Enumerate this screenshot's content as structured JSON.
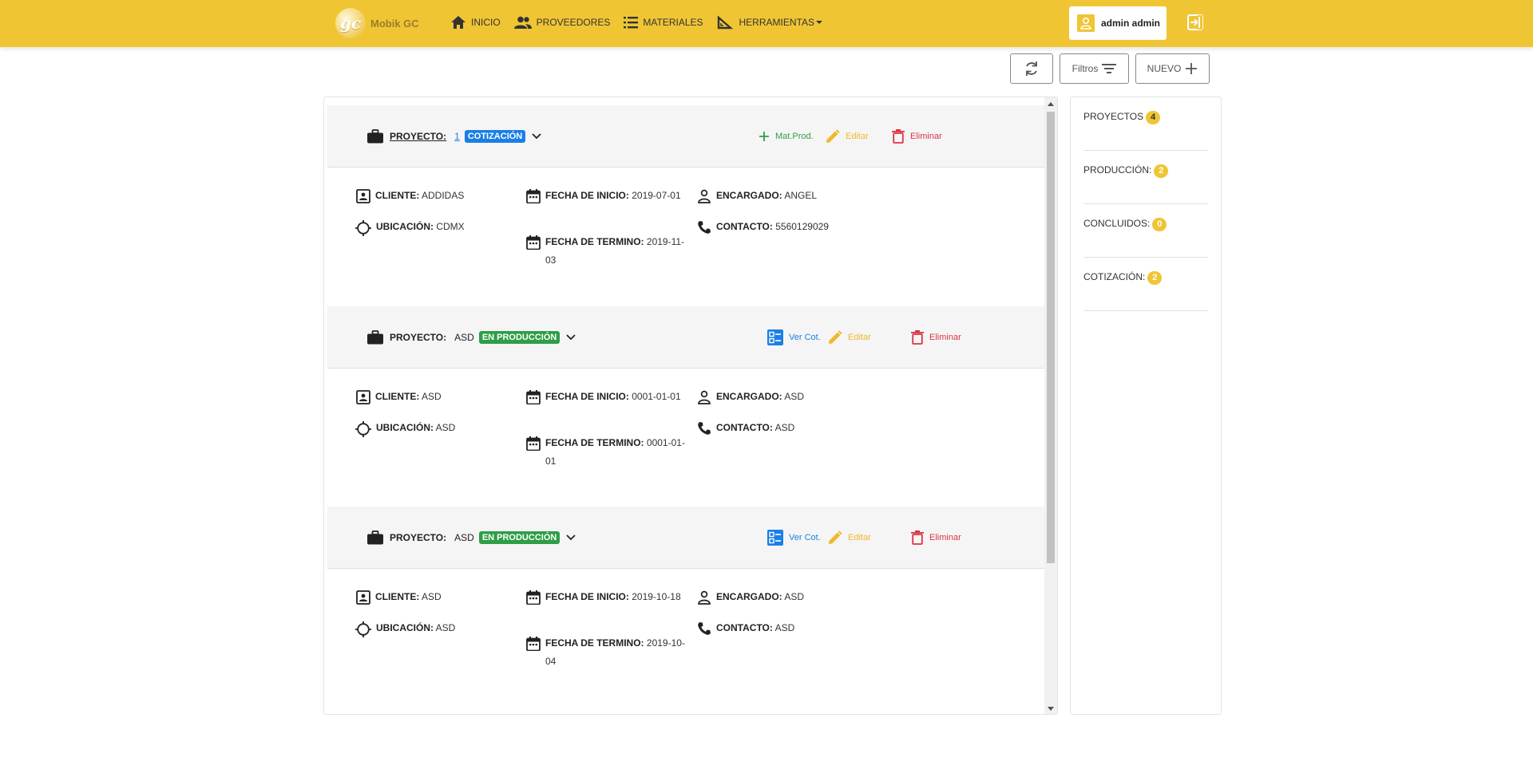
{
  "app": {
    "brand": "Mobik GC",
    "logo_text": "gc"
  },
  "nav": {
    "items": [
      {
        "label": "INICIO",
        "icon": "home-icon"
      },
      {
        "label": "PROVEEDORES",
        "icon": "users-icon"
      },
      {
        "label": "MATERIALES",
        "icon": "list-icon"
      },
      {
        "label": "HERRAMIENTAS",
        "icon": "ruler-icon"
      }
    ],
    "user": "admin admin"
  },
  "toolbar": {
    "filters_label": "Filtros",
    "new_label": "NUEVO"
  },
  "projects": [
    {
      "label": "PROYECTO:",
      "name": "1",
      "status": "COTIZACIÓN",
      "status_color": "#1a7fe6",
      "actions": [
        {
          "label": "Mat.Prod.",
          "icon": "plus-icon",
          "color": "#2e9e47"
        },
        {
          "label": "Editar",
          "icon": "pencil-icon",
          "color": "#f0b82d"
        },
        {
          "label": "Eliminar",
          "icon": "trash-icon",
          "color": "#dc3545"
        }
      ],
      "cliente_label": "CLIENTE:",
      "cliente": "ADDIDAS",
      "ubicacion_label": "UBICACIÓN:",
      "ubicacion": "CDMX",
      "inicio_label": "FECHA DE INICIO:",
      "inicio": "2019-07-01",
      "termino_label": "FECHA DE TERMINO:",
      "termino": "2019-11-03",
      "encargado_label": "ENCARGADO:",
      "encargado": "ANGEL",
      "contacto_label": "CONTACTO:",
      "contacto": "5560129029"
    },
    {
      "label": "PROYECTO:",
      "name": "ASD",
      "status": "EN PRODUCCIÓN",
      "status_color": "#2e9e47",
      "actions": [
        {
          "label": "Ver Cot.",
          "icon": "checklist-icon",
          "color": "#1a7fe6"
        },
        {
          "label": "Editar",
          "icon": "pencil-icon",
          "color": "#f0b82d"
        },
        {
          "label": "Eliminar",
          "icon": "trash-icon",
          "color": "#dc3545"
        }
      ],
      "cliente_label": "CLIENTE:",
      "cliente": "ASD",
      "ubicacion_label": "UBICACIÓN:",
      "ubicacion": "ASD",
      "inicio_label": "FECHA DE INICIO:",
      "inicio": "0001-01-01",
      "termino_label": "FECHA DE TERMINO:",
      "termino": "0001-01-01",
      "encargado_label": "ENCARGADO:",
      "encargado": "ASD",
      "contacto_label": "CONTACTO:",
      "contacto": "ASD"
    },
    {
      "label": "PROYECTO:",
      "name": "ASD",
      "status": "EN PRODUCCIÓN",
      "status_color": "#2e9e47",
      "actions": [
        {
          "label": "Ver Cot.",
          "icon": "checklist-icon",
          "color": "#1a7fe6"
        },
        {
          "label": "Editar",
          "icon": "pencil-icon",
          "color": "#f0b82d"
        },
        {
          "label": "Eliminar",
          "icon": "trash-icon",
          "color": "#dc3545"
        }
      ],
      "cliente_label": "CLIENTE:",
      "cliente": "ASD",
      "ubicacion_label": "UBICACIÓN:",
      "ubicacion": "ASD",
      "inicio_label": "FECHA DE INICIO:",
      "inicio": "2019-10-18",
      "termino_label": "FECHA DE TERMINO:",
      "termino": "2019-10-04",
      "encargado_label": "ENCARGADO:",
      "encargado": "ASD",
      "contacto_label": "CONTACTO:",
      "contacto": "ASD"
    }
  ],
  "summary": [
    {
      "label": "PROYECTOS",
      "count": "4"
    },
    {
      "label": "PRODUCCIÓN:",
      "count": "2"
    },
    {
      "label": "CONCLUIDOS:",
      "count": "0"
    },
    {
      "label": "COTIZACIÓN:",
      "count": "2"
    }
  ],
  "colors": {
    "brand": "#f0c534",
    "header_bg": "#f5f5f5"
  }
}
